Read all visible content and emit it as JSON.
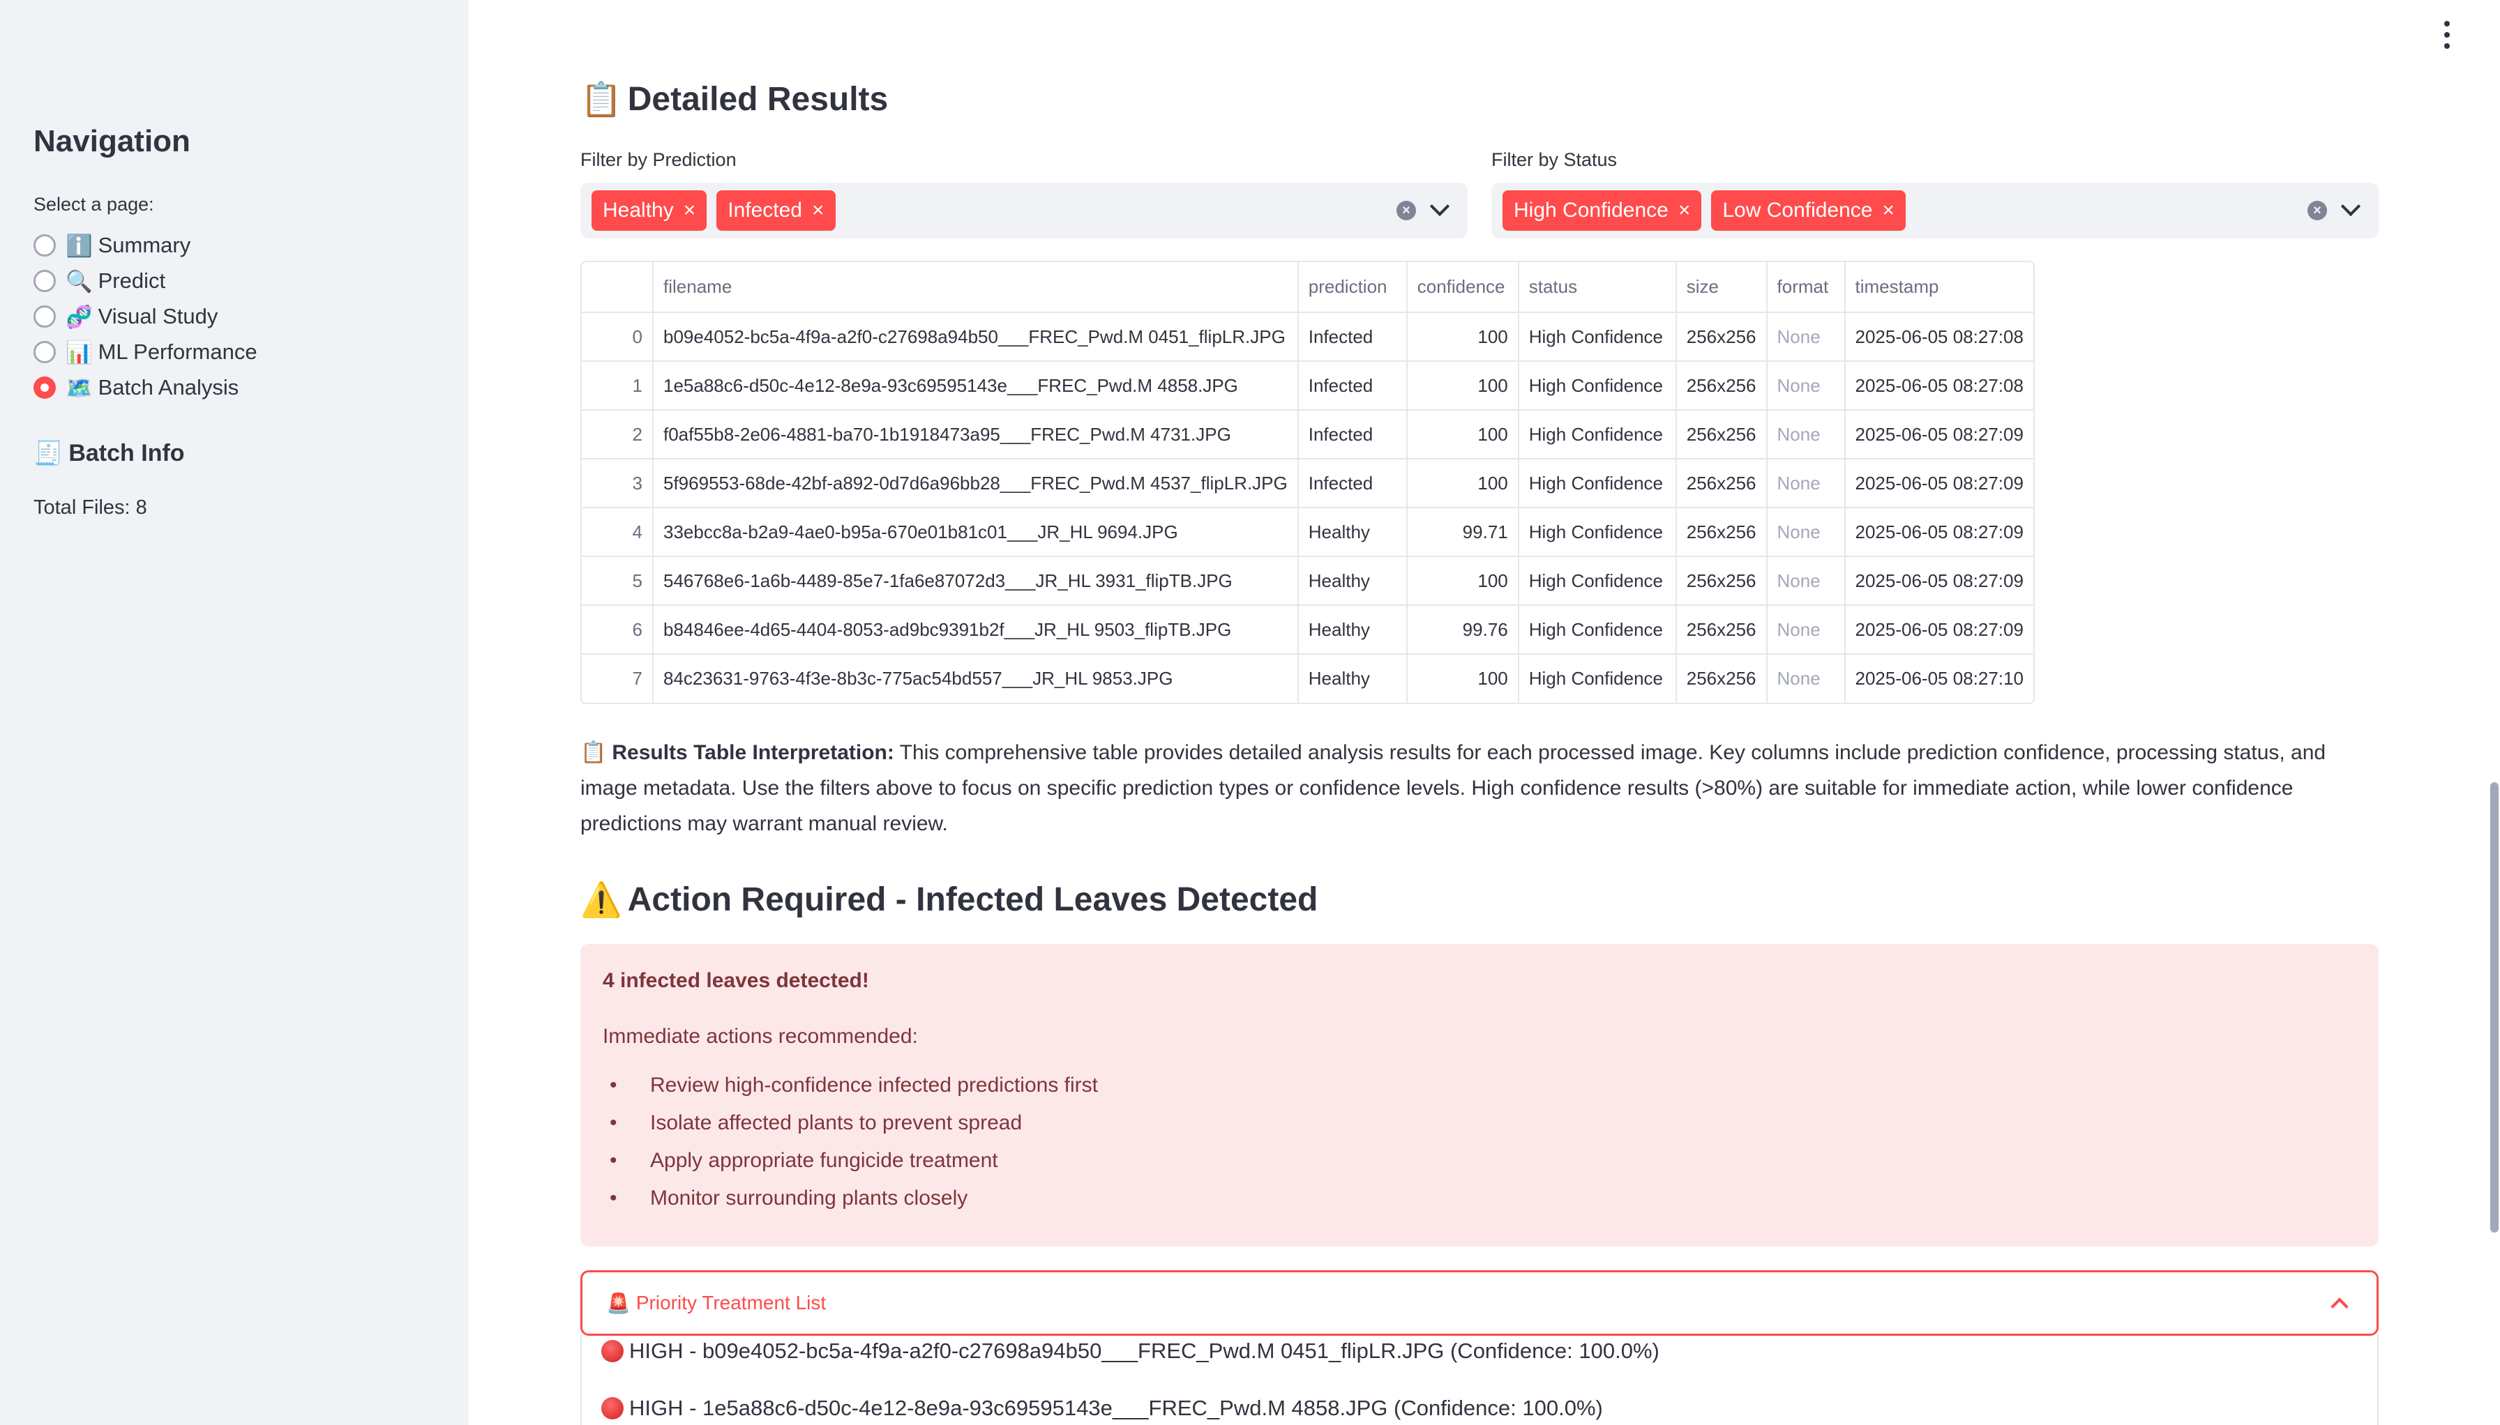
{
  "sidebar": {
    "title": "Navigation",
    "select_label": "Select a page:",
    "pages": [
      {
        "icon": "ℹ️",
        "label": "Summary",
        "selected": false
      },
      {
        "icon": "🔍",
        "label": "Predict",
        "selected": false
      },
      {
        "icon": "🧬",
        "label": "Visual Study",
        "selected": false
      },
      {
        "icon": "📊",
        "label": "ML Performance",
        "selected": false
      },
      {
        "icon": "🗺️",
        "label": "Batch Analysis",
        "selected": true
      }
    ],
    "batch_info_icon": "🧾",
    "batch_info_title": "Batch Info",
    "total_files": "Total Files: 8"
  },
  "main": {
    "detailed_icon": "📋",
    "detailed_title": "Detailed Results",
    "filter_prediction": {
      "label": "Filter by Prediction",
      "chips": [
        "Healthy",
        "Infected"
      ]
    },
    "filter_status": {
      "label": "Filter by Status",
      "chips": [
        "High Confidence",
        "Low Confidence"
      ]
    },
    "table": {
      "columns": [
        "filename",
        "prediction",
        "confidence",
        "status",
        "size",
        "format",
        "timestamp"
      ],
      "rows": [
        [
          "0",
          "b09e4052-bc5a-4f9a-a2f0-c27698a94b50___FREC_Pwd.M 0451_flipLR.JPG",
          "Infected",
          "100",
          "High Confidence",
          "256x256",
          "None",
          "2025-06-05 08:27:08"
        ],
        [
          "1",
          "1e5a88c6-d50c-4e12-8e9a-93c69595143e___FREC_Pwd.M 4858.JPG",
          "Infected",
          "100",
          "High Confidence",
          "256x256",
          "None",
          "2025-06-05 08:27:08"
        ],
        [
          "2",
          "f0af55b8-2e06-4881-ba70-1b1918473a95___FREC_Pwd.M 4731.JPG",
          "Infected",
          "100",
          "High Confidence",
          "256x256",
          "None",
          "2025-06-05 08:27:09"
        ],
        [
          "3",
          "5f969553-68de-42bf-a892-0d7d6a96bb28___FREC_Pwd.M 4537_flipLR.JPG",
          "Infected",
          "100",
          "High Confidence",
          "256x256",
          "None",
          "2025-06-05 08:27:09"
        ],
        [
          "4",
          "33ebcc8a-b2a9-4ae0-b95a-670e01b81c01___JR_HL 9694.JPG",
          "Healthy",
          "99.71",
          "High Confidence",
          "256x256",
          "None",
          "2025-06-05 08:27:09"
        ],
        [
          "5",
          "546768e6-1a6b-4489-85e7-1fa6e87072d3___JR_HL 3931_flipTB.JPG",
          "Healthy",
          "100",
          "High Confidence",
          "256x256",
          "None",
          "2025-06-05 08:27:09"
        ],
        [
          "6",
          "b84846ee-4d65-4404-8053-ad9bc9391b2f___JR_HL 9503_flipTB.JPG",
          "Healthy",
          "99.76",
          "High Confidence",
          "256x256",
          "None",
          "2025-06-05 08:27:09"
        ],
        [
          "7",
          "84c23631-9763-4f3e-8b3c-775ac54bd557___JR_HL 9853.JPG",
          "Healthy",
          "100",
          "High Confidence",
          "256x256",
          "None",
          "2025-06-05 08:27:10"
        ]
      ]
    },
    "interpretation": {
      "icon": "📋",
      "bold": "Results Table Interpretation:",
      "text": " This comprehensive table provides detailed analysis results for each processed image. Key columns include prediction confidence, processing status, and image metadata. Use the filters above to focus on specific prediction types or confidence levels. High confidence results (>80%) are suitable for immediate action, while lower confidence predictions may warrant manual review."
    },
    "action_icon": "⚠️",
    "action_title": "Action Required - Infected Leaves Detected",
    "alert": {
      "title": "4 infected leaves detected!",
      "intro": "Immediate actions recommended:",
      "items": [
        "Review high-confidence infected predictions first",
        "Isolate affected plants to prevent spread",
        "Apply appropriate fungicide treatment",
        "Monitor surrounding plants closely"
      ]
    },
    "expander": {
      "icon": "🚨",
      "label": "Priority Treatment List",
      "items": [
        "HIGH - b09e4052-bc5a-4f9a-a2f0-c27698a94b50___FREC_Pwd.M 0451_flipLR.JPG (Confidence: 100.0%)",
        "HIGH - 1e5a88c6-d50c-4e12-8e9a-93c69595143e___FREC_Pwd.M 4858.JPG (Confidence: 100.0%)"
      ]
    }
  },
  "colors": {
    "accent": "#ff4b4b",
    "sidebar_bg": "#f0f2f6",
    "alert_bg": "#fde8e9",
    "alert_text": "#7d353b"
  }
}
